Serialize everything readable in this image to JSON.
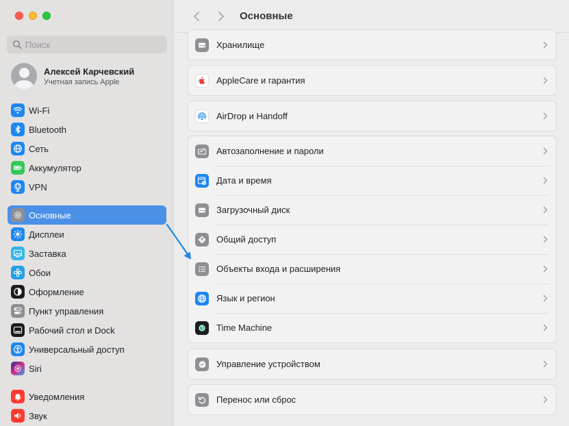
{
  "window": {
    "title": "Основные"
  },
  "search": {
    "placeholder": "Поиск",
    "value": ""
  },
  "account": {
    "name": "Алексей Карчевский",
    "subtitle": "Учетная запись Apple"
  },
  "sidebar": {
    "group1": [
      {
        "label": "Wi-Fi",
        "icon": "wifi-icon",
        "color": "#1e87f0"
      },
      {
        "label": "Bluetooth",
        "icon": "bluetooth-icon",
        "color": "#1e87f0"
      },
      {
        "label": "Сеть",
        "icon": "globe-icon",
        "color": "#1e87f0"
      },
      {
        "label": "Аккумулятор",
        "icon": "battery-icon",
        "color": "#34c759"
      },
      {
        "label": "VPN",
        "icon": "vpn-icon",
        "color": "#1e87f0"
      }
    ],
    "group2": [
      {
        "label": "Основные",
        "icon": "gear-icon",
        "color": "#8e8e93",
        "active": true
      },
      {
        "label": "Дисплеи",
        "icon": "sun-icon",
        "color": "#1e87f0"
      },
      {
        "label": "Заставка",
        "icon": "screensaver-icon",
        "color": "#36b4e6"
      },
      {
        "label": "Обои",
        "icon": "flower-icon",
        "color": "#25a0e6"
      },
      {
        "label": "Оформление",
        "icon": "appearance-icon",
        "color": "#1c1c1e"
      },
      {
        "label": "Пункт управления",
        "icon": "control-center-icon",
        "color": "#8e8e93"
      },
      {
        "label": "Рабочий стол и Dock",
        "icon": "dock-icon",
        "color": "#1c1c1e"
      },
      {
        "label": "Универсальный доступ",
        "icon": "accessibility-icon",
        "color": "#1e87f0"
      },
      {
        "label": "Siri",
        "icon": "siri-icon",
        "color": "#7a4fd6"
      }
    ],
    "group3": [
      {
        "label": "Уведомления",
        "icon": "bell-icon",
        "color": "#ff3b30"
      },
      {
        "label": "Звук",
        "icon": "speaker-icon",
        "color": "#ff3b30"
      }
    ]
  },
  "main": {
    "cards": [
      {
        "rows": [
          {
            "label": "Хранилище",
            "icon": "storage-icon",
            "color": "#8e8e93"
          }
        ]
      },
      {
        "rows": [
          {
            "label": "AppleCare и гарантия",
            "icon": "apple-icon",
            "color": "#ffffff"
          }
        ]
      },
      {
        "rows": [
          {
            "label": "AirDrop и Handoff",
            "icon": "airdrop-icon",
            "color": "#ffffff"
          }
        ]
      },
      {
        "rows": [
          {
            "label": "Автозаполнение и пароли",
            "icon": "autofill-icon",
            "color": "#8e8e93"
          },
          {
            "label": "Дата и время",
            "icon": "calendar-clock-icon",
            "color": "#1e87f0"
          },
          {
            "label": "Загрузочный диск",
            "icon": "disk-icon",
            "color": "#8e8e93"
          },
          {
            "label": "Общий доступ",
            "icon": "sharing-icon",
            "color": "#8e8e93"
          },
          {
            "label": "Объекты входа и расширения",
            "icon": "list-icon",
            "color": "#8e8e93"
          },
          {
            "label": "Язык и регион",
            "icon": "language-globe-icon",
            "color": "#1e87f0"
          },
          {
            "label": "Time Machine",
            "icon": "time-machine-icon",
            "color": "#1c1c1e"
          }
        ]
      },
      {
        "rows": [
          {
            "label": "Управление устройством",
            "icon": "device-management-icon",
            "color": "#8e8e93"
          }
        ]
      },
      {
        "rows": [
          {
            "label": "Перенос или сброс",
            "icon": "reset-icon",
            "color": "#8e8e93"
          }
        ]
      }
    ]
  },
  "colors": {
    "accent": "#4a90e7",
    "annotation_arrow": "#1e88e5"
  }
}
